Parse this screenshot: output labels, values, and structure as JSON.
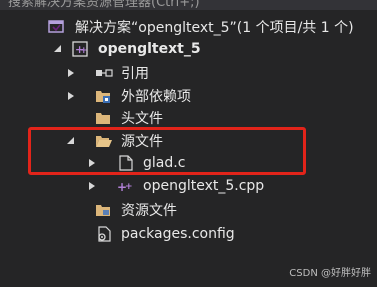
{
  "search": {
    "placeholder_text": "搜索解决方案资源管理器(Ctrl+;)"
  },
  "tree": {
    "solution_label": "解决方案“opengltext_5”(1 个项目/共 1 个)",
    "project_label": "opengltext_5",
    "references_label": "引用",
    "external_deps_label": "外部依赖项",
    "header_files_label": "头文件",
    "source_files_label": "源文件",
    "glad_c_label": "glad.c",
    "main_cpp_label": "opengltext_5.cpp",
    "resource_files_label": "资源文件",
    "packages_config_label": "packages.config"
  },
  "watermark": "CSDN @好胖好胖",
  "colors": {
    "background": "#252526",
    "highlight_border": "#e2241a",
    "text": "#e8e8e8"
  }
}
